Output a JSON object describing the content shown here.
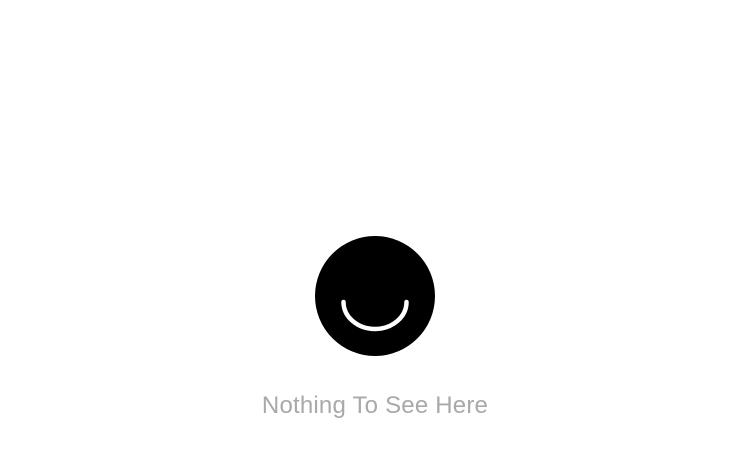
{
  "empty_state": {
    "logo_icon": "smiley-logo-icon",
    "message": "Nothing To See Here"
  },
  "colors": {
    "background": "#ffffff",
    "logo_fill": "#000000",
    "logo_smile": "#ffffff",
    "message_text": "#a9a9a9"
  }
}
